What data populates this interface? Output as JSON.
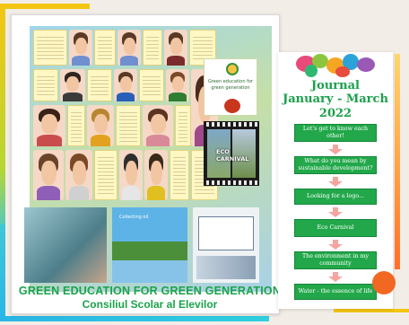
{
  "collage": {
    "title": "GREEN EDUCATION FOR GREEN GENERATION",
    "subtitle": "Consiliul Scolar al Elevilor",
    "poster_text": "Green education for green generation",
    "film_label": "ECO CARNIVAL",
    "photo_caption": "Collecting oil"
  },
  "journal": {
    "title_line1": "Journal",
    "title_line2": "January - March",
    "title_line3": "2022",
    "steps": [
      "Let's get to know each other!",
      "What do you mean by sustainable development?",
      "Looking for a logo...",
      "Eco Carnival",
      "The environment in my community",
      "Water - the essence of life"
    ]
  },
  "colors": {
    "accent_green": "#1aa34a",
    "step_green": "#22a84a",
    "frame_yellow": "#f3c613",
    "frame_cyan": "#29b6e6",
    "dot_orange": "#f26822"
  }
}
